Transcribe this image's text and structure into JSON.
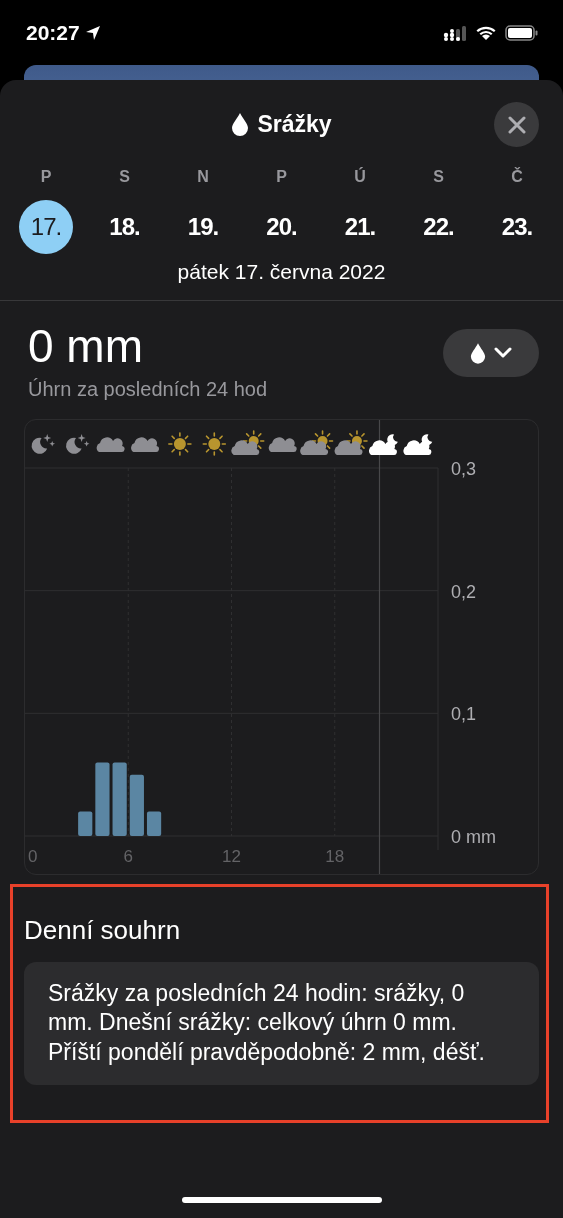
{
  "status_bar": {
    "time": "20:27"
  },
  "sheet": {
    "title": "Srážky"
  },
  "days": [
    {
      "weekday": "P",
      "date": "17.",
      "selected": true
    },
    {
      "weekday": "S",
      "date": "18.",
      "selected": false
    },
    {
      "weekday": "N",
      "date": "19.",
      "selected": false
    },
    {
      "weekday": "P",
      "date": "20.",
      "selected": false
    },
    {
      "weekday": "Ú",
      "date": "21.",
      "selected": false
    },
    {
      "weekday": "S",
      "date": "22.",
      "selected": false
    },
    {
      "weekday": "Č",
      "date": "23.",
      "selected": false
    }
  ],
  "selected_date": "pátek 17. června 2022",
  "summary_value": "0 mm",
  "summary_caption": "Úhrn za posledních 24 hod",
  "conditions": [
    {
      "kind": "moon-stars",
      "dimmed": true
    },
    {
      "kind": "moon-stars",
      "dimmed": true
    },
    {
      "kind": "cloud",
      "dimmed": true
    },
    {
      "kind": "cloud",
      "dimmed": true
    },
    {
      "kind": "sun",
      "dimmed": true
    },
    {
      "kind": "sun",
      "dimmed": true
    },
    {
      "kind": "cloud-sun",
      "dimmed": true
    },
    {
      "kind": "cloud",
      "dimmed": true
    },
    {
      "kind": "cloud-sun",
      "dimmed": true
    },
    {
      "kind": "cloud-sun",
      "dimmed": true
    },
    {
      "kind": "cloud-moon",
      "dimmed": false
    },
    {
      "kind": "cloud-moon",
      "dimmed": false
    }
  ],
  "chart": {
    "chart_data": {
      "type": "bar",
      "x": [
        0.5,
        1.5,
        2.5,
        3.5,
        4.5,
        5.5,
        6.5,
        7.5,
        8.5,
        9.5,
        10.5,
        11.5,
        12.5,
        13.5,
        14.5,
        15.5,
        16.5,
        17.5,
        18.5,
        19.5,
        20.5,
        21.5,
        22.5,
        23.5
      ],
      "series": [
        {
          "color": "#5b86a3",
          "values": [
            0,
            0,
            0,
            0.02,
            0.06,
            0.06,
            0.05,
            0.02,
            0,
            0,
            0,
            0,
            0,
            0,
            0,
            0,
            0,
            0,
            0,
            0,
            0,
            0,
            0,
            0
          ]
        }
      ],
      "xlim": [
        0,
        24
      ],
      "ylim": [
        0,
        0.3
      ],
      "xticks": [
        0,
        6,
        12,
        18
      ],
      "grid": true,
      "ref_lines": [
        {
          "axis": "x",
          "value": 20.6
        }
      ],
      "yticks": [
        {
          "value": 0.3,
          "label": "0,3"
        },
        {
          "value": 0.2,
          "label": "0,2"
        },
        {
          "value": 0.1,
          "label": "0,1"
        },
        {
          "value": 0,
          "label": "0 mm"
        }
      ]
    }
  },
  "daily_summary": {
    "heading": "Denní souhrn",
    "text": "Srážky za posledních 24 hodin: srážky, 0 mm. Dnešní srážky: celkový úhrn 0 mm. Příští pondělí pravděpodobně: 2 mm, déšť."
  }
}
